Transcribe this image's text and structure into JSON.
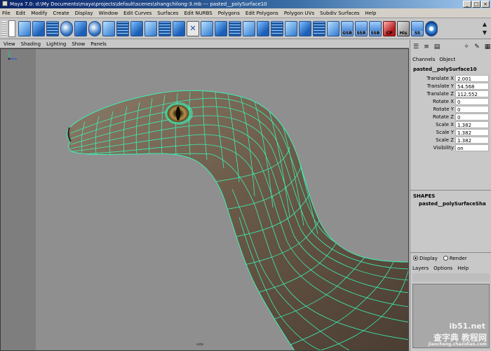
{
  "window": {
    "title": "Maya 7.0: d:\\My Documents\\maya\\projects\\default\\scenes\\shangchilong-3.mb  ---  pasted__polySurface10"
  },
  "menubar": {
    "items": [
      "File",
      "Edit",
      "Modify",
      "Create",
      "Display",
      "Window",
      "Edit Curves",
      "Surfaces",
      "Edit NURBS",
      "Polygons",
      "Edit Polygons",
      "Polygon UVs",
      "Subdiv Surfaces",
      "Help"
    ]
  },
  "shelf": {
    "labels": {
      "gsb": "GSB",
      "ssr": "SSR",
      "ssb": "SSB",
      "cp": "CP",
      "his": "His",
      "ss": "SS"
    }
  },
  "panel": {
    "menu": [
      "View",
      "Shading",
      "Lighting",
      "Show",
      "Panels"
    ],
    "camera_label": "side"
  },
  "channel_box": {
    "menu": [
      "Channels",
      "Object"
    ],
    "object_name": "pasted__polySurface10",
    "channels": [
      {
        "label": "Translate X",
        "value": "2.001"
      },
      {
        "label": "Translate Y",
        "value": "54.568"
      },
      {
        "label": "Translate Z",
        "value": "112.552"
      },
      {
        "label": "Rotate X",
        "value": "0"
      },
      {
        "label": "Rotate Y",
        "value": "0"
      },
      {
        "label": "Rotate Z",
        "value": "0"
      },
      {
        "label": "Scale X",
        "value": "1.382"
      },
      {
        "label": "Scale Y",
        "value": "1.382"
      },
      {
        "label": "Scale Z",
        "value": "1.382"
      },
      {
        "label": "Visibility",
        "value": "on"
      }
    ],
    "shapes_heading": "SHAPES",
    "shape_name": "pasted__polySurfaceSha"
  },
  "layer_editor": {
    "display_label": "Display",
    "render_label": "Render",
    "menu": [
      "Layers",
      "Options",
      "Help"
    ]
  },
  "watermark": {
    "line1": "ib51.net",
    "line2": "查字典 教程网",
    "line3": "jiaocheng.chazidian.com"
  },
  "colors": {
    "wireframe": "#3cf0b4",
    "viewport_bg": "#8f8f8f",
    "skin": "#6b5a48"
  }
}
